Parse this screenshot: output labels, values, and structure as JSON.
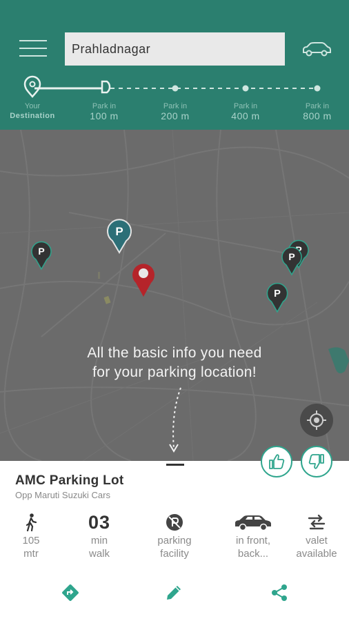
{
  "header": {
    "search_value": "Prahladnagar",
    "distance_stops": [
      {
        "line1": "Your",
        "line2": "Destination"
      },
      {
        "line1": "Park in",
        "line2": "100 m"
      },
      {
        "line1": "Park in",
        "line2": "200 m"
      },
      {
        "line1": "Park in",
        "line2": "400 m"
      },
      {
        "line1": "Park in",
        "line2": "800 m"
      }
    ]
  },
  "map": {
    "caption_line1": "All the basic info you need",
    "caption_line2": "for your parking location!",
    "parking_pin_label": "P"
  },
  "sheet": {
    "name": "AMC Parking Lot",
    "subtitle": "Opp Maruti Suzuki Cars",
    "info": [
      {
        "icon": "walking-icon",
        "line1": "105",
        "line2": "mtr"
      },
      {
        "icon": "",
        "big": "03",
        "line1": "min",
        "line2": "walk"
      },
      {
        "icon": "no-parking-facility-icon",
        "line1": "parking",
        "line2": "facility"
      },
      {
        "icon": "car-icon",
        "line1": "in front,",
        "line2": "back..."
      },
      {
        "icon": "valet-icon",
        "line1": "valet",
        "line2": "available"
      }
    ]
  },
  "colors": {
    "header": "#2b7f6f",
    "accent": "#2fa58d",
    "destination_pin": "#b5242a"
  }
}
